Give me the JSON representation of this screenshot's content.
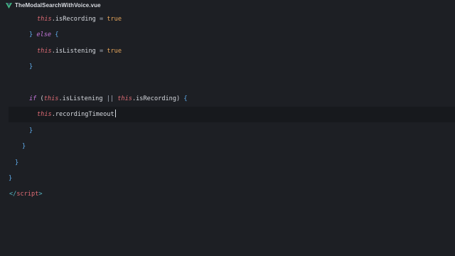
{
  "tab": {
    "icon": "vue-logo-icon",
    "filename": "TheModalSearchWithVoice.vue"
  },
  "code": {
    "l1": {
      "this": "this",
      "prop": ".isRecording",
      "op": " = ",
      "val": "true"
    },
    "l2": {
      "brace": "}",
      "kw": "else",
      "brace2": "{"
    },
    "l3": {
      "this": "this",
      "prop": ".isListening",
      "op": " = ",
      "val": "true"
    },
    "l4": {
      "brace": "}"
    },
    "l6": {
      "kw": "if",
      "paren_open": "(",
      "this1": "this",
      "prop1": ".isListening",
      "op": " || ",
      "this2": "this",
      "prop2": ".isRecording",
      "paren_close": ")",
      "brace": "{"
    },
    "l7": {
      "this": "this",
      "prop": ".recordingTimeout"
    },
    "l8": {
      "brace": "}"
    },
    "l9": {
      "brace": "}"
    },
    "l10": {
      "brace": "}"
    },
    "l11": {
      "brace": "}"
    },
    "l12": {
      "open": "</",
      "tag": "script",
      "close": ">"
    }
  },
  "colors": {
    "background": "#1d1f24",
    "active_line": "#17191d",
    "this_keyword": "#e06c75",
    "control_keyword": "#c678dd",
    "boolean": "#e5a55b",
    "brace": "#61afef",
    "vue_green": "#41b883"
  }
}
